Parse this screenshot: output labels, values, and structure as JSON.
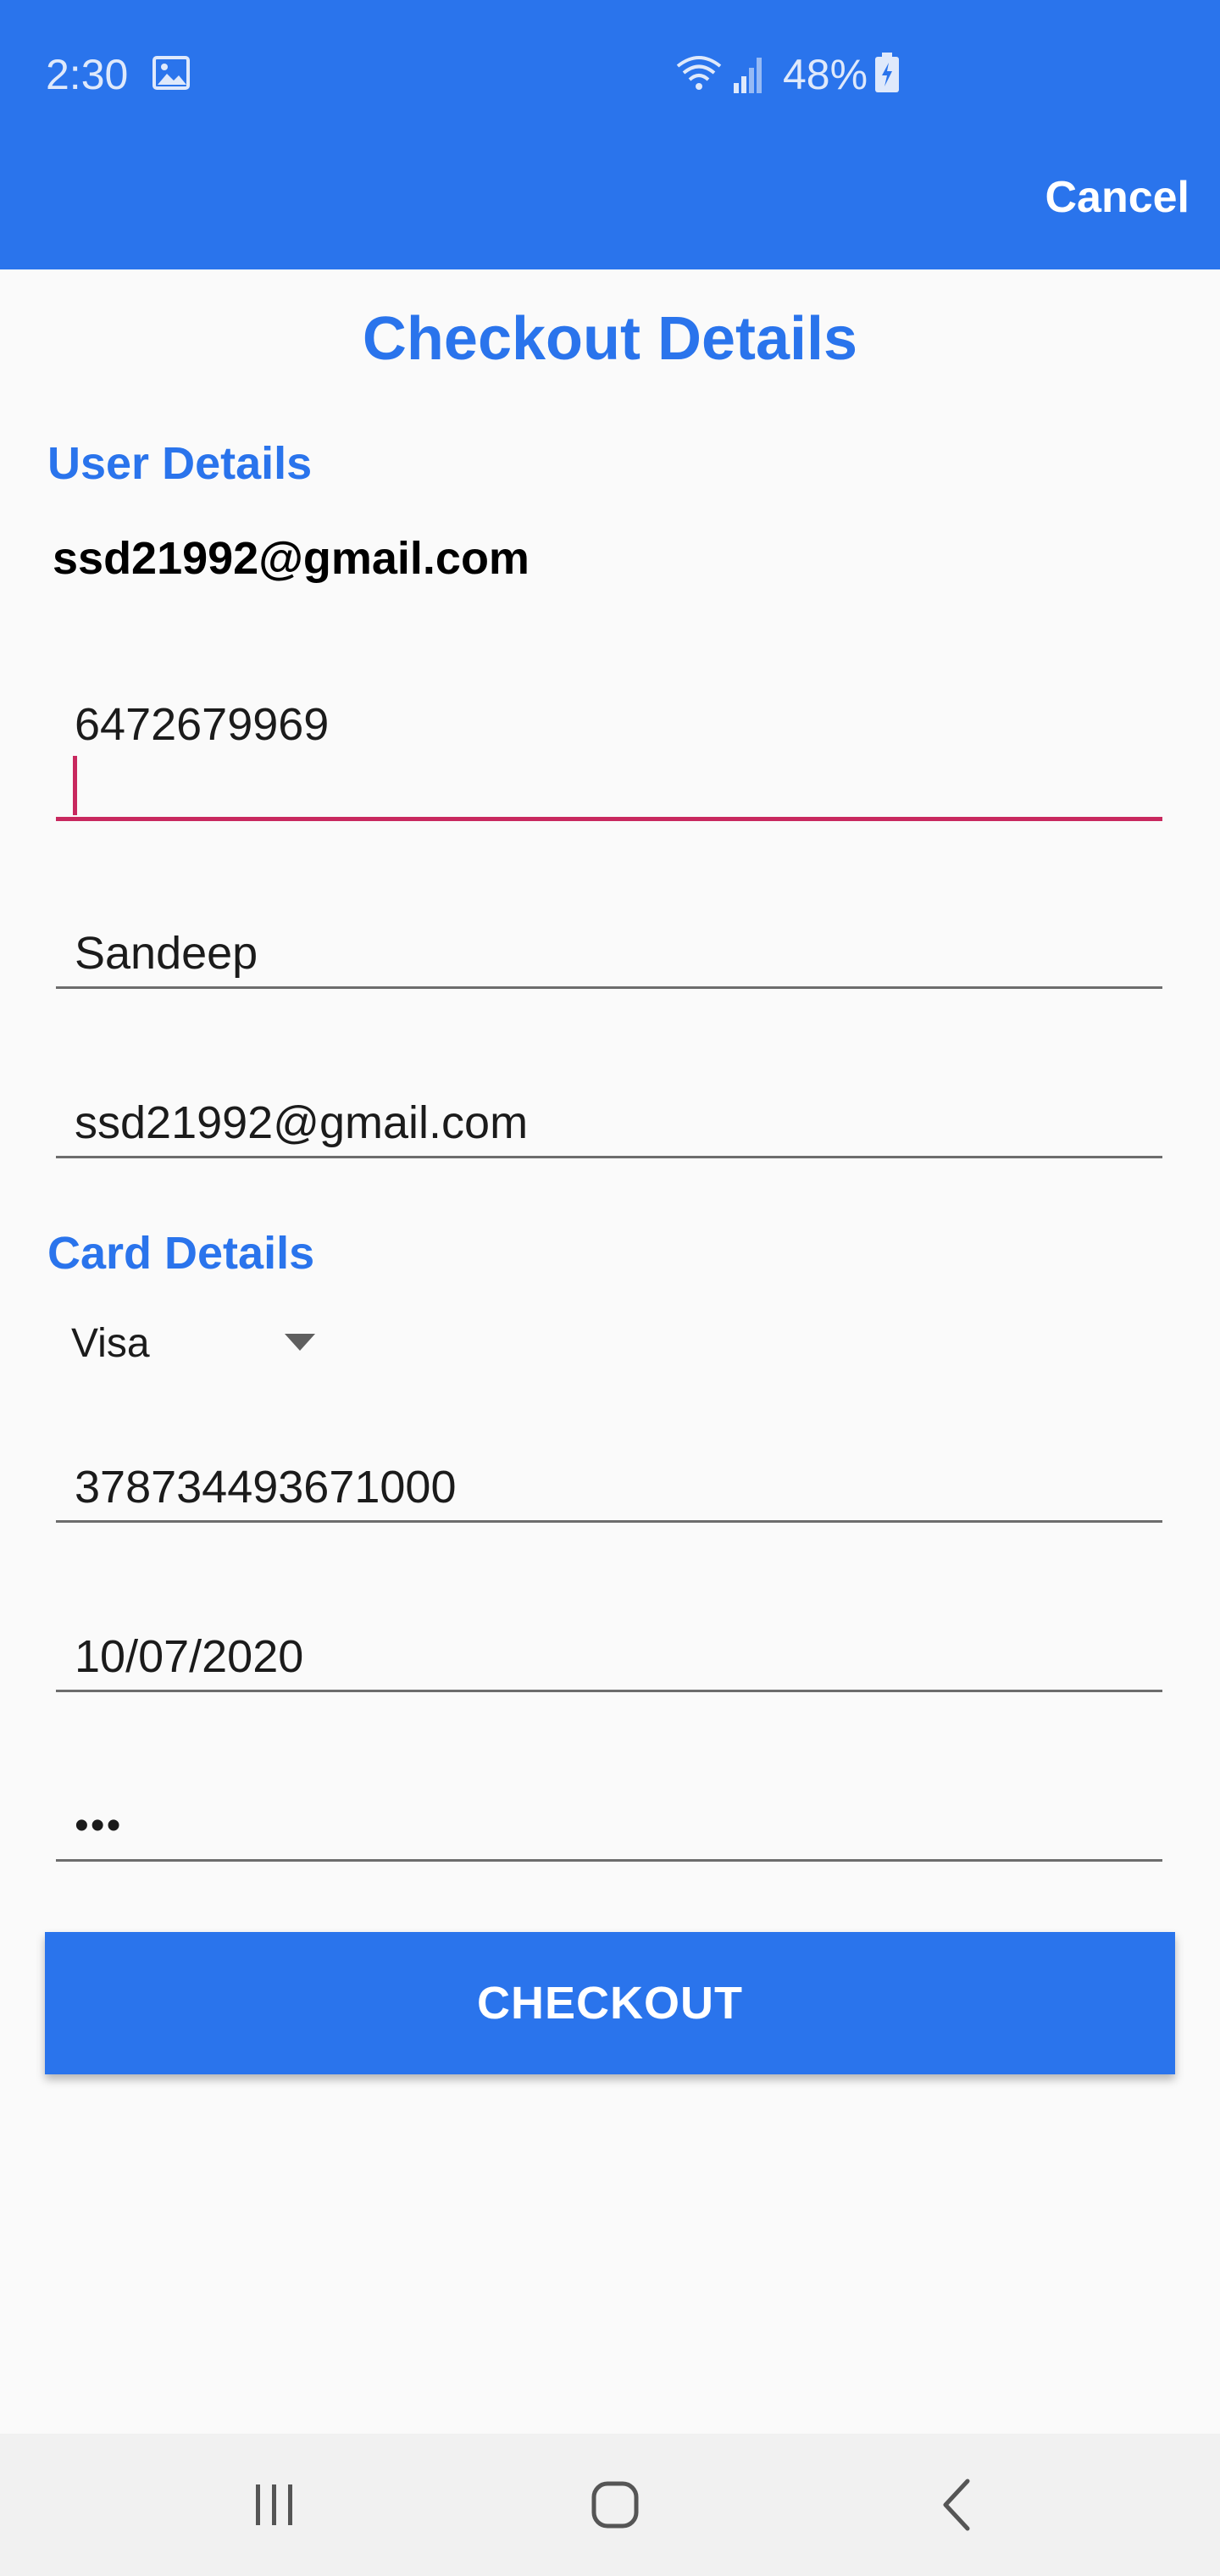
{
  "status_bar": {
    "time": "2:30",
    "battery": "48%",
    "icons": [
      "image-icon",
      "wifi-icon",
      "signal-icon",
      "battery-icon"
    ]
  },
  "header": {
    "cancel_label": "Cancel",
    "background_color": "#2a74ec"
  },
  "page": {
    "title": "Checkout Details"
  },
  "user_details": {
    "section_label": "User Details",
    "account_email": "ssd21992@gmail.com",
    "phone": "6472679969",
    "name": "Sandeep",
    "email": "ssd21992@gmail.com"
  },
  "card_details": {
    "section_label": "Card Details",
    "card_type": "Visa",
    "card_number": "378734493671000",
    "expiry": "10/07/2020",
    "cvv_masked": "•••"
  },
  "actions": {
    "checkout_label": "CHECKOUT"
  },
  "colors": {
    "accent": "#2a74ec",
    "focus": "#c8285e"
  },
  "nav_bar": {
    "icons": [
      "recent-apps-icon",
      "home-icon",
      "back-icon"
    ]
  }
}
